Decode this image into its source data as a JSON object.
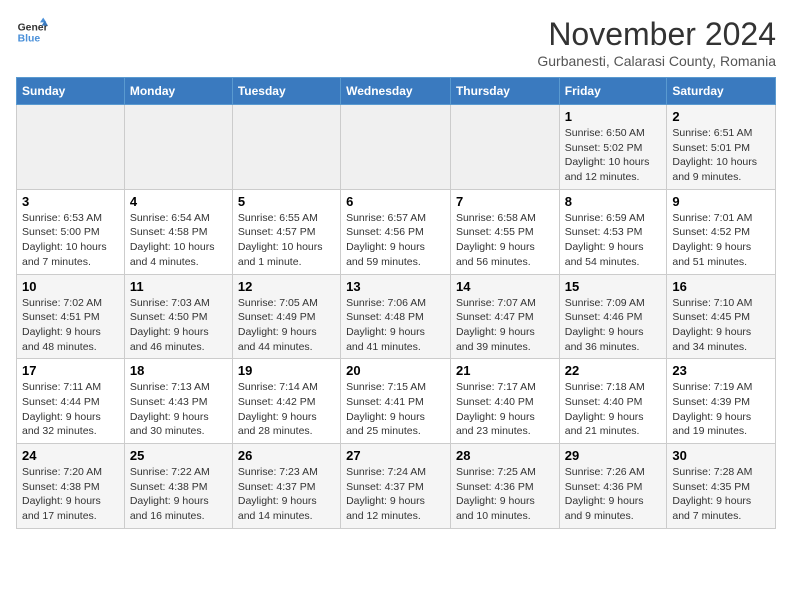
{
  "header": {
    "logo_line1": "General",
    "logo_line2": "Blue",
    "title": "November 2024",
    "subtitle": "Gurbanesti, Calarasi County, Romania"
  },
  "weekdays": [
    "Sunday",
    "Monday",
    "Tuesday",
    "Wednesday",
    "Thursday",
    "Friday",
    "Saturday"
  ],
  "weeks": [
    [
      {
        "day": "",
        "detail": ""
      },
      {
        "day": "",
        "detail": ""
      },
      {
        "day": "",
        "detail": ""
      },
      {
        "day": "",
        "detail": ""
      },
      {
        "day": "",
        "detail": ""
      },
      {
        "day": "1",
        "detail": "Sunrise: 6:50 AM\nSunset: 5:02 PM\nDaylight: 10 hours\nand 12 minutes."
      },
      {
        "day": "2",
        "detail": "Sunrise: 6:51 AM\nSunset: 5:01 PM\nDaylight: 10 hours\nand 9 minutes."
      }
    ],
    [
      {
        "day": "3",
        "detail": "Sunrise: 6:53 AM\nSunset: 5:00 PM\nDaylight: 10 hours\nand 7 minutes."
      },
      {
        "day": "4",
        "detail": "Sunrise: 6:54 AM\nSunset: 4:58 PM\nDaylight: 10 hours\nand 4 minutes."
      },
      {
        "day": "5",
        "detail": "Sunrise: 6:55 AM\nSunset: 4:57 PM\nDaylight: 10 hours\nand 1 minute."
      },
      {
        "day": "6",
        "detail": "Sunrise: 6:57 AM\nSunset: 4:56 PM\nDaylight: 9 hours\nand 59 minutes."
      },
      {
        "day": "7",
        "detail": "Sunrise: 6:58 AM\nSunset: 4:55 PM\nDaylight: 9 hours\nand 56 minutes."
      },
      {
        "day": "8",
        "detail": "Sunrise: 6:59 AM\nSunset: 4:53 PM\nDaylight: 9 hours\nand 54 minutes."
      },
      {
        "day": "9",
        "detail": "Sunrise: 7:01 AM\nSunset: 4:52 PM\nDaylight: 9 hours\nand 51 minutes."
      }
    ],
    [
      {
        "day": "10",
        "detail": "Sunrise: 7:02 AM\nSunset: 4:51 PM\nDaylight: 9 hours\nand 48 minutes."
      },
      {
        "day": "11",
        "detail": "Sunrise: 7:03 AM\nSunset: 4:50 PM\nDaylight: 9 hours\nand 46 minutes."
      },
      {
        "day": "12",
        "detail": "Sunrise: 7:05 AM\nSunset: 4:49 PM\nDaylight: 9 hours\nand 44 minutes."
      },
      {
        "day": "13",
        "detail": "Sunrise: 7:06 AM\nSunset: 4:48 PM\nDaylight: 9 hours\nand 41 minutes."
      },
      {
        "day": "14",
        "detail": "Sunrise: 7:07 AM\nSunset: 4:47 PM\nDaylight: 9 hours\nand 39 minutes."
      },
      {
        "day": "15",
        "detail": "Sunrise: 7:09 AM\nSunset: 4:46 PM\nDaylight: 9 hours\nand 36 minutes."
      },
      {
        "day": "16",
        "detail": "Sunrise: 7:10 AM\nSunset: 4:45 PM\nDaylight: 9 hours\nand 34 minutes."
      }
    ],
    [
      {
        "day": "17",
        "detail": "Sunrise: 7:11 AM\nSunset: 4:44 PM\nDaylight: 9 hours\nand 32 minutes."
      },
      {
        "day": "18",
        "detail": "Sunrise: 7:13 AM\nSunset: 4:43 PM\nDaylight: 9 hours\nand 30 minutes."
      },
      {
        "day": "19",
        "detail": "Sunrise: 7:14 AM\nSunset: 4:42 PM\nDaylight: 9 hours\nand 28 minutes."
      },
      {
        "day": "20",
        "detail": "Sunrise: 7:15 AM\nSunset: 4:41 PM\nDaylight: 9 hours\nand 25 minutes."
      },
      {
        "day": "21",
        "detail": "Sunrise: 7:17 AM\nSunset: 4:40 PM\nDaylight: 9 hours\nand 23 minutes."
      },
      {
        "day": "22",
        "detail": "Sunrise: 7:18 AM\nSunset: 4:40 PM\nDaylight: 9 hours\nand 21 minutes."
      },
      {
        "day": "23",
        "detail": "Sunrise: 7:19 AM\nSunset: 4:39 PM\nDaylight: 9 hours\nand 19 minutes."
      }
    ],
    [
      {
        "day": "24",
        "detail": "Sunrise: 7:20 AM\nSunset: 4:38 PM\nDaylight: 9 hours\nand 17 minutes."
      },
      {
        "day": "25",
        "detail": "Sunrise: 7:22 AM\nSunset: 4:38 PM\nDaylight: 9 hours\nand 16 minutes."
      },
      {
        "day": "26",
        "detail": "Sunrise: 7:23 AM\nSunset: 4:37 PM\nDaylight: 9 hours\nand 14 minutes."
      },
      {
        "day": "27",
        "detail": "Sunrise: 7:24 AM\nSunset: 4:37 PM\nDaylight: 9 hours\nand 12 minutes."
      },
      {
        "day": "28",
        "detail": "Sunrise: 7:25 AM\nSunset: 4:36 PM\nDaylight: 9 hours\nand 10 minutes."
      },
      {
        "day": "29",
        "detail": "Sunrise: 7:26 AM\nSunset: 4:36 PM\nDaylight: 9 hours\nand 9 minutes."
      },
      {
        "day": "30",
        "detail": "Sunrise: 7:28 AM\nSunset: 4:35 PM\nDaylight: 9 hours\nand 7 minutes."
      }
    ]
  ]
}
